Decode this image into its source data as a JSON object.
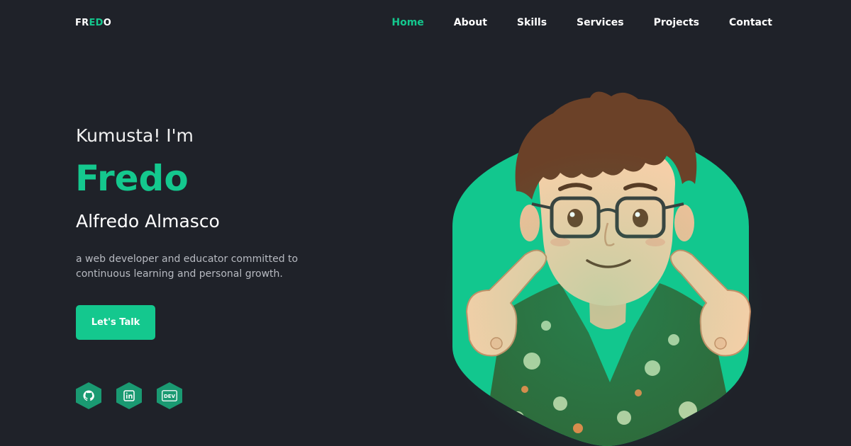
{
  "logo": {
    "part1": "FR",
    "part2": "ED",
    "part3": "O"
  },
  "nav": {
    "items": [
      {
        "label": "Home",
        "active": true
      },
      {
        "label": "About"
      },
      {
        "label": "Skills"
      },
      {
        "label": "Services"
      },
      {
        "label": "Projects"
      },
      {
        "label": "Contact"
      }
    ]
  },
  "hero": {
    "greeting": "Kumusta! I'm",
    "name": "Fredo",
    "fullname": "Alfredo Almasco",
    "tagline": "a web developer and educator committed to continuous learning and personal growth.",
    "cta_label": "Let's Talk"
  },
  "socials": [
    {
      "icon": "github-icon"
    },
    {
      "icon": "linkedin-icon"
    },
    {
      "icon": "dev-icon",
      "label": "DEV"
    }
  ],
  "colors": {
    "background": "#1f2229",
    "accent": "#14c88e",
    "social_bg": "#1a9a72"
  }
}
